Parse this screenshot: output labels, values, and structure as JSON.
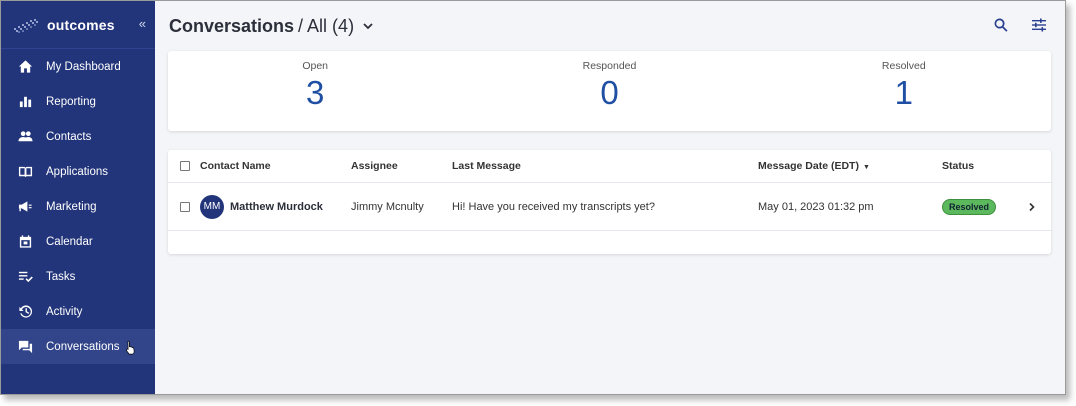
{
  "brand": {
    "name": "outcomes",
    "collapse_glyph": "«"
  },
  "sidebar": {
    "items": [
      {
        "label": "My Dashboard",
        "icon": "home-icon"
      },
      {
        "label": "Reporting",
        "icon": "bar-chart-icon"
      },
      {
        "label": "Contacts",
        "icon": "people-icon"
      },
      {
        "label": "Applications",
        "icon": "book-icon"
      },
      {
        "label": "Marketing",
        "icon": "megaphone-icon"
      },
      {
        "label": "Calendar",
        "icon": "calendar-icon"
      },
      {
        "label": "Tasks",
        "icon": "checklist-icon"
      },
      {
        "label": "Activity",
        "icon": "history-icon"
      },
      {
        "label": "Conversations",
        "icon": "chat-icon",
        "active": true
      }
    ]
  },
  "header": {
    "title": "Conversations",
    "filter": "/ All (4)"
  },
  "stats": [
    {
      "label": "Open",
      "value": "3"
    },
    {
      "label": "Responded",
      "value": "0"
    },
    {
      "label": "Resolved",
      "value": "1"
    }
  ],
  "table": {
    "columns": {
      "contact": "Contact Name",
      "assignee": "Assignee",
      "last_message": "Last Message",
      "date": "Message Date (EDT)",
      "status": "Status"
    },
    "rows": [
      {
        "initials": "MM",
        "contact": "Matthew Murdock",
        "assignee": "Jimmy Mcnulty",
        "last_message": "Hi! Have you received my transcripts yet?",
        "date": "May 01, 2023 01:32 pm",
        "status": "Resolved"
      }
    ]
  },
  "colors": {
    "sidebar": "#23357a",
    "accent": "#1f4fa3",
    "resolved": "#5cb85c"
  }
}
